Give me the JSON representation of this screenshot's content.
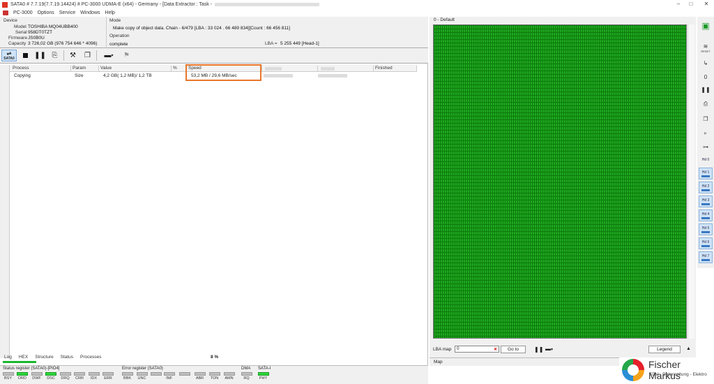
{
  "window": {
    "title": "SATA0 # 7.7.19(7.7.19.14424) # PC-3000 UDMA-E (x64) - Germany - [Data Extractor : Task -",
    "controls": [
      "–",
      "□",
      "✕"
    ]
  },
  "menu": [
    "PC-3000",
    "Options",
    "Service",
    "Windows",
    "Help"
  ],
  "device": {
    "heading": "Device",
    "model_label": "Model",
    "model": "TOSHIBA MQ04UBB400",
    "serial_label": "Serial",
    "serial": "958DT0TZT",
    "firmware_label": "Firmware",
    "firmware": "JS0B0U",
    "capacity_label": "Capacity",
    "capacity": "3 726,02 GB (976 754 646 * 4096)"
  },
  "mode": {
    "heading": "Mode",
    "text": "Make copy of object data. Chain - 6/479 [LBA : 33 024 . 66 489 834][Count : 66 456 811]",
    "operation_label": "Operation",
    "operation_status": "complete",
    "lba_label": "LBA =",
    "lba_value": "5 255 449  [Head-1]"
  },
  "toolbar": {
    "sata_label": "SATA0"
  },
  "grid": {
    "columns": [
      "Process",
      "Param",
      "Value",
      "%",
      "Speed",
      "",
      "",
      "Finished"
    ],
    "row": {
      "process": "Copying",
      "param": "Size",
      "value": "4,2 GB( 1,2 MB)/ 1,2 TB",
      "speed": "53,2 MB / 29,6 MB/sec"
    }
  },
  "bottom_tabs": [
    "Log",
    "HEX",
    "Structure",
    "Status",
    "Processes"
  ],
  "progress": {
    "percent_label": "8 %",
    "fraction": 0.08
  },
  "status_register": {
    "title": "Status register (SATA0)-[PIO4]",
    "bits": [
      {
        "name": "BSY",
        "on": false
      },
      {
        "name": "DRD",
        "on": true
      },
      {
        "name": "DWF",
        "on": false
      },
      {
        "name": "DSC",
        "on": true
      },
      {
        "name": "DRQ",
        "on": false
      },
      {
        "name": "CRR",
        "on": false
      },
      {
        "name": "IDX",
        "on": false
      },
      {
        "name": "ERR",
        "on": false
      }
    ]
  },
  "error_register": {
    "title": "Error register (SATA0)",
    "bits": [
      {
        "name": "BBK",
        "on": false
      },
      {
        "name": "UNC",
        "on": false
      },
      {
        "name": "INF",
        "on": false
      },
      {
        "name": "ABR",
        "on": false
      },
      {
        "name": "TON",
        "on": false
      },
      {
        "name": "AMN",
        "on": false
      }
    ]
  },
  "dma": {
    "title": "DMA",
    "bit": "RQ",
    "on": false
  },
  "sata_i": {
    "title": "SATA-I",
    "bit": "PHY",
    "on": true
  },
  "map": {
    "title": "0 - Default",
    "lba_map_label": "LBA map",
    "lba_map_value": "0",
    "goto_label": "Go to",
    "legend_label": "Legend",
    "tab_label": "Map"
  },
  "right_strip": {
    "hd_labels": [
      "Hd 0",
      "Hd 1",
      "Hd 2",
      "Hd 3",
      "Hd 4",
      "Hd 5",
      "Hd 6",
      "Hd 7"
    ],
    "reset_label": "RESET"
  },
  "watermark": {
    "name": "Fischer Markus",
    "subtitle": "EDV - Datenrettung - Elektro"
  },
  "colors": {
    "map_green": "#1fa81f",
    "highlight_orange": "#e8762b",
    "led_on": "#2dd63c"
  }
}
